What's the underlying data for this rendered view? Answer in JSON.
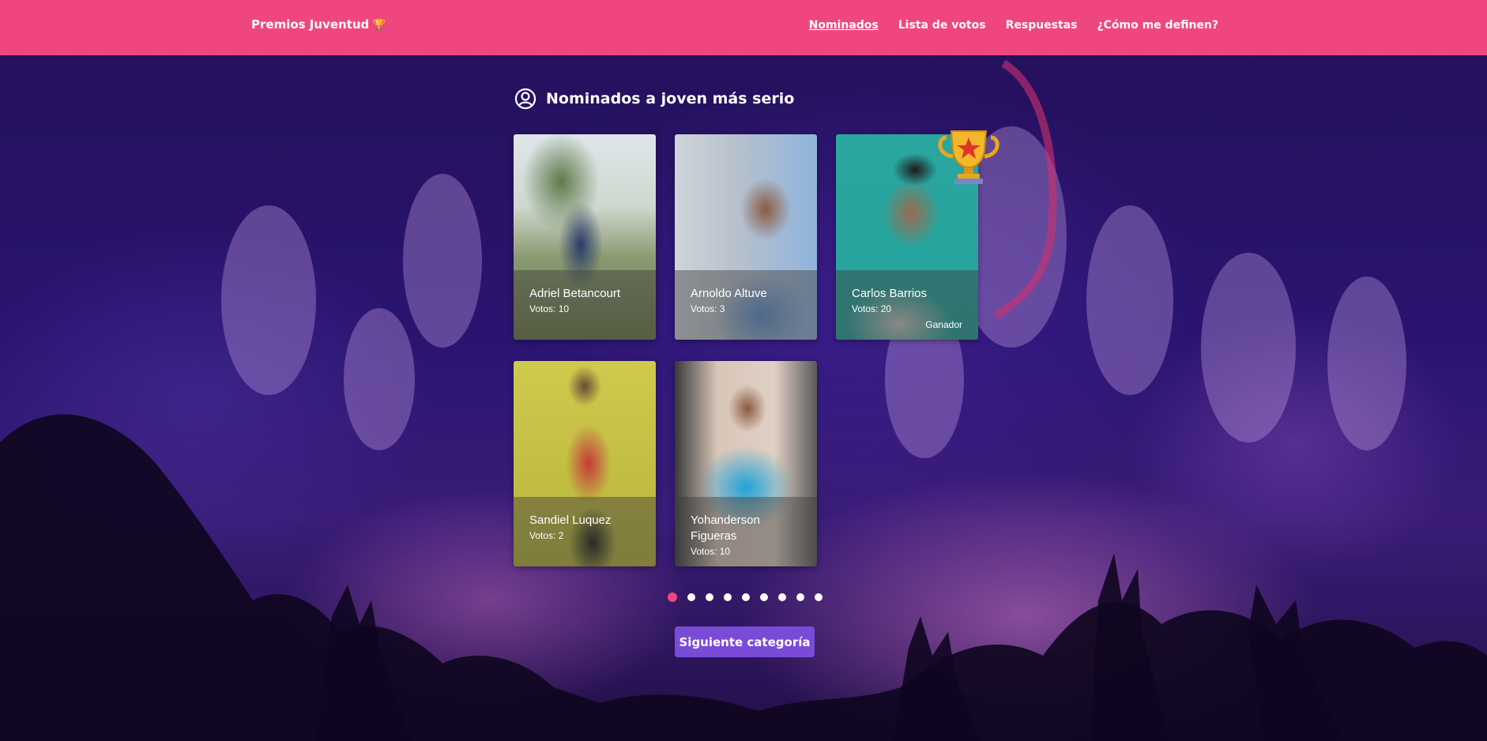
{
  "navbar": {
    "brand": "Premios Juventud",
    "links": [
      {
        "label": "Nominados",
        "active": true
      },
      {
        "label": "Lista de votos",
        "active": false
      },
      {
        "label": "Respuestas",
        "active": false
      },
      {
        "label": "¿Cómo me definen?",
        "active": false
      }
    ]
  },
  "main": {
    "title": "Nominados a joven más serio",
    "nominees": [
      {
        "name": "Adriel Betancourt",
        "votes": "Votos: 10"
      },
      {
        "name": "Arnoldo Altuve",
        "votes": "Votos: 3"
      },
      {
        "name": "Carlos Barrios",
        "votes": "Votos: 20",
        "badge": "Ganador"
      },
      {
        "name": "Sandiel Luquez",
        "votes": "Votos: 2"
      },
      {
        "name": "Yohanderson Figueras",
        "votes": "Votos: 10"
      }
    ],
    "pagination": {
      "total": 9,
      "current": 1
    },
    "next_button": "Siguiente categoría"
  },
  "colors": {
    "navbar": "#f0467f",
    "accent_dot": "#f0467f",
    "button": "#7a4bd6",
    "background": "#2a1470"
  },
  "icons": [
    "trophy-icon",
    "user-circle-icon",
    "winner-trophy-icon"
  ]
}
